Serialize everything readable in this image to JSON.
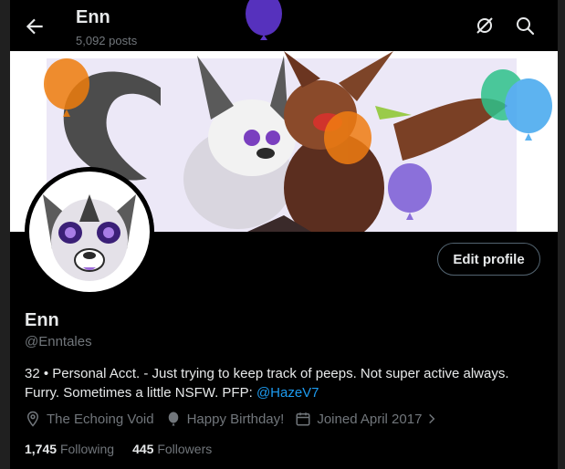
{
  "header": {
    "title": "Enn",
    "posts": "5,092 posts"
  },
  "icons": {
    "back": "arrow-left-icon",
    "refresh": "hide-balloons-icon",
    "search": "search-icon",
    "location": "location-pin-icon",
    "birthday": "balloon-icon",
    "joined": "calendar-icon",
    "chevron": "chevron-right-icon"
  },
  "profile": {
    "name": "Enn",
    "handle": "@Enntales",
    "edit_label": "Edit profile",
    "bio_text": "32 • Personal Acct. - Just trying to keep track of peeps. Not super active always. Furry. Sometimes a little NSFW. PFP: ",
    "bio_link": "@HazeV7",
    "location": "The Echoing Void",
    "birthday": "Happy Birthday!",
    "joined": "Joined April 2017",
    "following_count": "1,745",
    "following_label": "Following",
    "followers_count": "445",
    "followers_label": "Followers"
  },
  "colors": {
    "accent": "#1d9bf0",
    "background": "#000000",
    "muted": "#71767b",
    "text": "#e7e9ea"
  }
}
